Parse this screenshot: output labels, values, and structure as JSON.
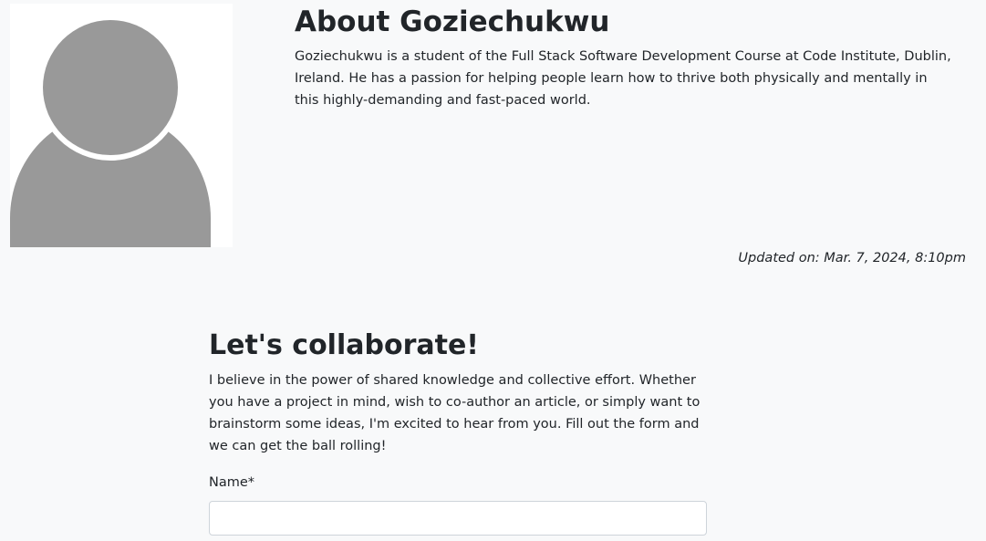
{
  "about": {
    "title": "About Goziechukwu",
    "bio": "Goziechukwu is a student of the Full Stack Software Development Course at Code Institute, Dublin, Ireland. He has a passion for helping people learn how to thrive both physically and mentally in this highly-demanding and fast-paced world.",
    "updated": "Updated on: Mar. 7, 2024, 8:10pm",
    "avatar_icon": "user-placeholder-icon"
  },
  "collaborate": {
    "title": "Let's collaborate!",
    "text": "I believe in the power of shared knowledge and collective effort. Whether you have a project in mind, wish to co-author an article, or simply want to brainstorm some ideas, I'm excited to hear from you. Fill out the form and we can get the ball rolling!",
    "name_label": "Name*",
    "name_value": ""
  },
  "colors": {
    "background": "#f8f9fa",
    "avatar_fill": "#999999",
    "text": "#212529",
    "input_border": "#ced4da"
  }
}
